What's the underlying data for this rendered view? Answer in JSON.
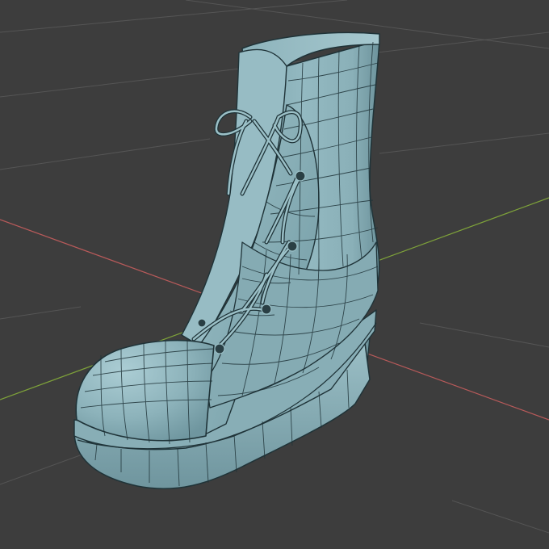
{
  "viewport": {
    "background_color": "#3d3d3d",
    "grid_color": "#555555",
    "x_axis_color": "#b85a5a",
    "y_axis_color": "#7ea23a"
  },
  "model": {
    "object": "boot",
    "display_mode": "wireframe-on-shaded",
    "surface_color": "#8eb4bc",
    "surface_shadow_color": "#6f969f",
    "surface_highlight_color": "#a9cbd2",
    "wire_color": "#1f3338",
    "eyelet_count": 5,
    "parts": [
      "shaft",
      "vamp",
      "toe-cap",
      "tongue",
      "laces",
      "eyelets",
      "midsole",
      "outsole",
      "heel"
    ]
  },
  "icons": [
    "boot-model-icon"
  ]
}
